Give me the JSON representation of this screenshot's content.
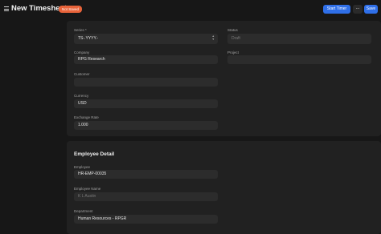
{
  "header": {
    "title": "New Timesheet",
    "status_badge": "Not Saved",
    "start_timer_label": "Start Timer",
    "more_label": "...",
    "save_label": "Save"
  },
  "details": {
    "series": {
      "label": "Series *",
      "value": "TS-.YYYY.-"
    },
    "status": {
      "label": "Status",
      "value": "Draft"
    },
    "company": {
      "label": "Company",
      "value": "RPG Research"
    },
    "project": {
      "label": "Project",
      "value": ""
    },
    "customer": {
      "label": "Customer",
      "value": ""
    },
    "currency": {
      "label": "Currency",
      "value": "USD"
    },
    "exchange_rate": {
      "label": "Exchange Rate",
      "value": "1.000"
    }
  },
  "employee_detail": {
    "title": "Employee Detail",
    "employee": {
      "label": "Employee",
      "value": "HR-EMP-00035"
    },
    "employee_name": {
      "label": "Employee Name",
      "value": "K L Austin"
    },
    "department": {
      "label": "Department",
      "value": "Human Resources - RPGR"
    }
  },
  "colors": {
    "background": "#171717",
    "card": "#212121",
    "field": "#2c2c2c",
    "primary": "#2f6fe8",
    "badge": "#e8633a"
  }
}
